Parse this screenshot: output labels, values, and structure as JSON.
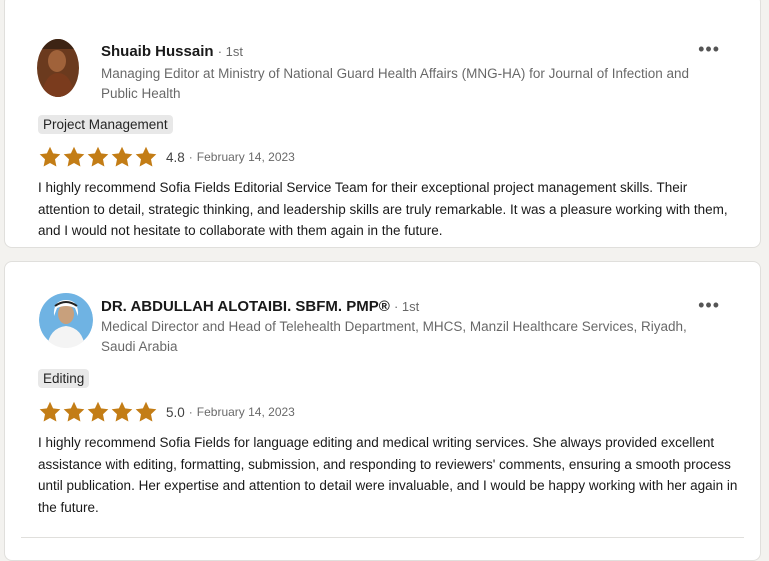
{
  "colors": {
    "star": "#c37d16",
    "tag_bg": "#e8e8e8"
  },
  "recommendations": [
    {
      "name": "Shuaib Hussain",
      "degree": "· 1st",
      "headline": "Managing Editor at Ministry of National Guard Health Affairs (MNG-HA) for Journal of Infection and Public Health",
      "tag": "Project Management",
      "rating": "4.8",
      "rating_value": 4.8,
      "separator": "·",
      "date": "February 14, 2023",
      "text": "I highly recommend Sofia Fields Editorial Service Team for their exceptional project management skills. Their attention to detail, strategic thinking, and leadership skills are truly remarkable. It was a pleasure working with them, and I would not hesitate to collaborate with them again in the future.",
      "more_icon": "ellipsis-icon"
    },
    {
      "name": "DR. ABDULLAH ALOTAIBI. SBFM. PMP®",
      "degree": "· 1st",
      "headline": "Medical Director and Head of Telehealth Department, MHCS, Manzil Healthcare Services, Riyadh, Saudi Arabia",
      "tag": "Editing",
      "rating": "5.0",
      "rating_value": 5.0,
      "separator": "·",
      "date": "February 14, 2023",
      "text": "I highly recommend Sofia Fields for language editing and medical writing services. She always provided excellent assistance with editing, formatting, submission, and responding to reviewers' comments, ensuring a smooth process until publication. Her expertise and attention to detail were invaluable, and I would be happy working with her again in the future.",
      "more_icon": "ellipsis-icon"
    }
  ]
}
